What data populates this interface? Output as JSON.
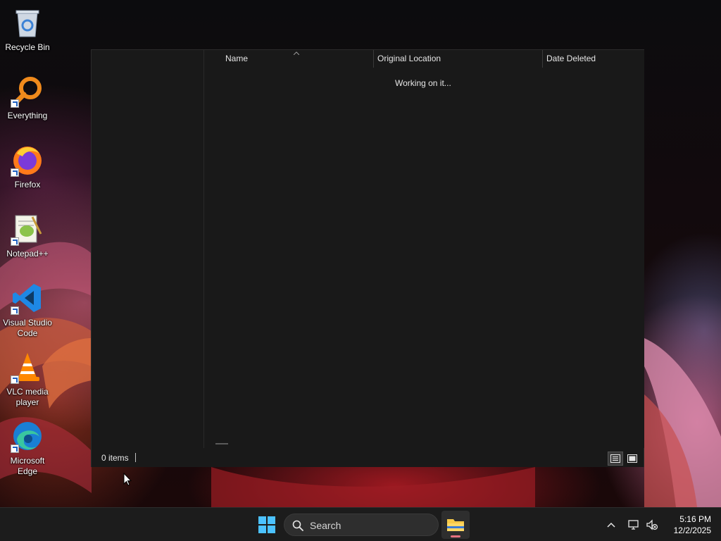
{
  "desktop": {
    "icons": [
      {
        "label": "Recycle Bin",
        "icon": "recycle-bin-icon",
        "shortcut": false
      },
      {
        "label": "Everything",
        "icon": "everything-search-icon",
        "shortcut": true
      },
      {
        "label": "Firefox",
        "icon": "firefox-icon",
        "shortcut": true
      },
      {
        "label": "Notepad++",
        "icon": "notepad-plus-plus-icon",
        "shortcut": true
      },
      {
        "label": "Visual Studio Code",
        "icon": "vscode-icon",
        "shortcut": true
      },
      {
        "label": "VLC media player",
        "icon": "vlc-icon",
        "shortcut": true
      },
      {
        "label": "Microsoft Edge",
        "icon": "edge-icon",
        "shortcut": true
      }
    ]
  },
  "explorer": {
    "columns": {
      "name": "Name",
      "original_location": "Original Location",
      "date_deleted": "Date Deleted"
    },
    "sort_indicator": "sort-ascending-caret",
    "loading_text": "Working on it...",
    "status": {
      "item_count": "0 items"
    },
    "view_buttons": [
      "details-view-icon",
      "large-icons-view-icon"
    ]
  },
  "taskbar": {
    "search_placeholder": "Search",
    "pinned": [
      "start-windows-icon",
      "file-explorer-icon"
    ],
    "tray_icons": [
      "show-hidden-icons-chevron",
      "network-icon",
      "volume-muted-icon"
    ],
    "time": "5:16 PM",
    "date": "12/2/2025"
  },
  "colors": {
    "window_bg": "#191919",
    "taskbar_bg": "#1c1c1c",
    "accent_indicator": "#e8737f"
  }
}
